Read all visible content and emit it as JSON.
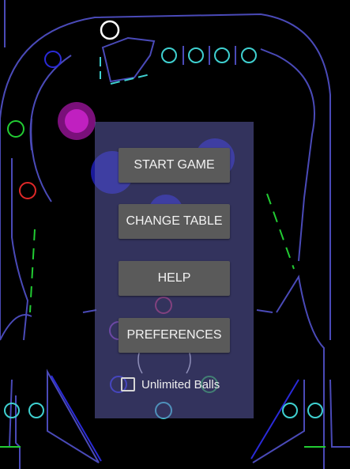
{
  "colors": {
    "background": "#000000",
    "table_outline": "#4a4ab8",
    "cyan_target": "#3fd0d0",
    "green_target": "#22cc33",
    "red_target": "#e02828",
    "magenta_bumper": "#c020c0",
    "white_target": "#ffffff",
    "menu_panel": "#5c5caa",
    "button_bg": "#5a5a5a",
    "button_text": "#f2f2f2"
  },
  "menu": {
    "buttons": [
      {
        "label": "START GAME"
      },
      {
        "label": "CHANGE TABLE"
      },
      {
        "label": "HELP"
      },
      {
        "label": "PREFERENCES"
      }
    ],
    "unlimited_balls": {
      "label": "Unlimited Balls",
      "checked": false
    }
  },
  "table": {
    "rollover_lights": 4,
    "side_lane_lights": 4
  }
}
